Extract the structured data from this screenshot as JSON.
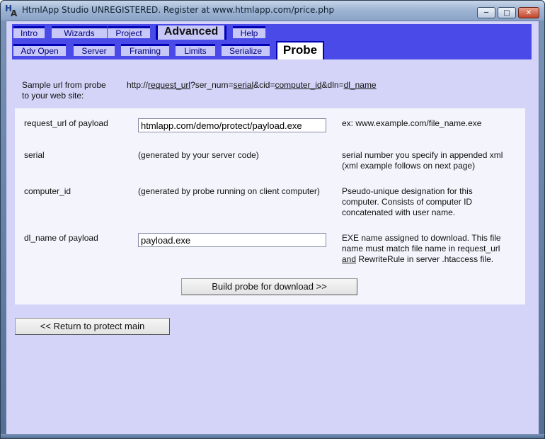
{
  "window": {
    "icon_letters": [
      "H",
      "A"
    ],
    "title": "HtmlApp Studio UNREGISTERED. Register at www.htmlapp.com/price.php",
    "minimize_icon": "minimize-icon",
    "maximize_icon": "maximize-icon",
    "close_icon": "close-icon"
  },
  "nav": {
    "row1": [
      "Intro",
      "Wizards",
      "Project",
      "Advanced",
      "Help"
    ],
    "row2": [
      "Adv Open",
      "Server",
      "Framing",
      "Limits",
      "Serialize",
      "Probe"
    ],
    "active_tab": "Probe"
  },
  "sample": {
    "label_line1": "Sample url from probe",
    "label_line2": "to your web site:",
    "url_prefix": "http://",
    "url_p1": "request_url",
    "url_mid1": "?ser_num=",
    "url_p2": "serial",
    "url_mid2": "&cid=",
    "url_p3": "computer_id",
    "url_mid3": "&dln=",
    "url_p4": "dl_name"
  },
  "rows": {
    "request_url": {
      "label": "request_url of payload",
      "value": "htmlapp.com/demo/protect/payload.exe",
      "note": "ex: www.example.com/file_name.exe"
    },
    "serial": {
      "label": "serial",
      "middle": "(generated by your server code)",
      "note_line1": "serial number you specify in appended xml",
      "note_line2": "(xml example follows on next page)"
    },
    "computer_id": {
      "label": "computer_id",
      "middle": "(generated by probe running on client computer)",
      "note_line1": "Pseudo-unique designation for this",
      "note_line2": "computer. Consists of computer ID",
      "note_line3": "concatenated with user name."
    },
    "dl_name": {
      "label": "dl_name of payload",
      "value": "payload.exe",
      "note_line1": "EXE name assigned to download. This file",
      "note_line2": "name must match file name in request_url",
      "note_line3_u": "and",
      "note_line3_rest": " RewriteRule in server .htaccess file."
    }
  },
  "buttons": {
    "build": "Build probe for download >>",
    "return": "<< Return to protect main"
  }
}
